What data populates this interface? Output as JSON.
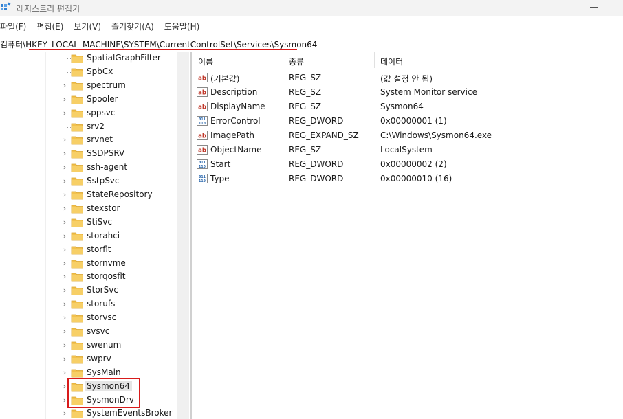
{
  "window": {
    "title": "레지스트리 편집기",
    "app_icon": "regedit-icon"
  },
  "menu": [
    "파일(F)",
    "편집(E)",
    "보기(V)",
    "즐겨찾기(A)",
    "도움말(H)"
  ],
  "address": {
    "path": "컴퓨터\\HKEY_LOCAL_MACHINE\\SYSTEM\\CurrentControlSet\\Services\\Sysmon64"
  },
  "tree": {
    "items": [
      {
        "label": "SpatialGraphFilter",
        "expandable": false
      },
      {
        "label": "SpbCx",
        "expandable": false
      },
      {
        "label": "spectrum",
        "expandable": true
      },
      {
        "label": "Spooler",
        "expandable": true
      },
      {
        "label": "sppsvc",
        "expandable": true
      },
      {
        "label": "srv2",
        "expandable": false
      },
      {
        "label": "srvnet",
        "expandable": true
      },
      {
        "label": "SSDPSRV",
        "expandable": true
      },
      {
        "label": "ssh-agent",
        "expandable": true
      },
      {
        "label": "SstpSvc",
        "expandable": true
      },
      {
        "label": "StateRepository",
        "expandable": true
      },
      {
        "label": "stexstor",
        "expandable": true
      },
      {
        "label": "StiSvc",
        "expandable": true
      },
      {
        "label": "storahci",
        "expandable": true
      },
      {
        "label": "storflt",
        "expandable": true
      },
      {
        "label": "stornvme",
        "expandable": true
      },
      {
        "label": "storqosflt",
        "expandable": true
      },
      {
        "label": "StorSvc",
        "expandable": true
      },
      {
        "label": "storufs",
        "expandable": true
      },
      {
        "label": "storvsc",
        "expandable": true
      },
      {
        "label": "svsvc",
        "expandable": true
      },
      {
        "label": "swenum",
        "expandable": true
      },
      {
        "label": "swprv",
        "expandable": true
      },
      {
        "label": "SysMain",
        "expandable": true
      },
      {
        "label": "Sysmon64",
        "expandable": true,
        "selected": true
      },
      {
        "label": "SysmonDrv",
        "expandable": true
      },
      {
        "label": "SystemEventsBroker",
        "expandable": true
      }
    ]
  },
  "columns": {
    "name": "이름",
    "type": "종류",
    "data": "데이터"
  },
  "values": [
    {
      "icon": "string-value-icon",
      "name": "(기본값)",
      "type": "REG_SZ",
      "data": "(값 설정 안 됨)"
    },
    {
      "icon": "string-value-icon",
      "name": "Description",
      "type": "REG_SZ",
      "data": "System Monitor service"
    },
    {
      "icon": "string-value-icon",
      "name": "DisplayName",
      "type": "REG_SZ",
      "data": "Sysmon64"
    },
    {
      "icon": "binary-value-icon",
      "name": "ErrorControl",
      "type": "REG_DWORD",
      "data": "0x00000001 (1)"
    },
    {
      "icon": "string-value-icon",
      "name": "ImagePath",
      "type": "REG_EXPAND_SZ",
      "data": "C:\\Windows\\Sysmon64.exe"
    },
    {
      "icon": "string-value-icon",
      "name": "ObjectName",
      "type": "REG_SZ",
      "data": "LocalSystem"
    },
    {
      "icon": "binary-value-icon",
      "name": "Start",
      "type": "REG_DWORD",
      "data": "0x00000002 (2)"
    },
    {
      "icon": "binary-value-icon",
      "name": "Type",
      "type": "REG_DWORD",
      "data": "0x00000010 (16)"
    }
  ],
  "colors": {
    "highlight": "#d81b1b",
    "folder": "#f2c14e",
    "selected_bg": "#e5e5e5"
  }
}
